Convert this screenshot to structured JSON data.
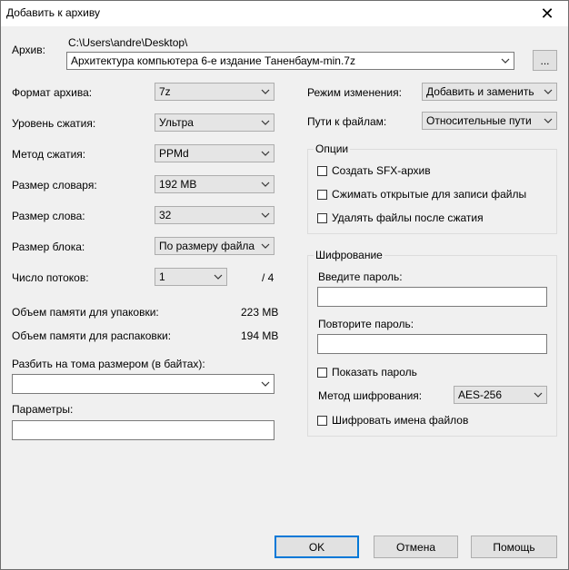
{
  "window": {
    "title": "Добавить к архиву"
  },
  "archive": {
    "label": "Архив:",
    "path": "C:\\Users\\andre\\Desktop\\",
    "filename": "Архитектура компьютера 6-е издание Таненбаум-min.7z",
    "browse": "..."
  },
  "left": {
    "format": {
      "label": "Формат архива:",
      "value": "7z"
    },
    "level": {
      "label": "Уровень сжатия:",
      "value": "Ультра"
    },
    "method": {
      "label": "Метод сжатия:",
      "value": "PPMd"
    },
    "dict": {
      "label": "Размер словаря:",
      "value": "192 MB"
    },
    "word": {
      "label": "Размер слова:",
      "value": "32"
    },
    "block": {
      "label": "Размер блока:",
      "value": "По размеру файла"
    },
    "threads": {
      "label": "Число потоков:",
      "value": "1",
      "max": "/ 4"
    },
    "mem_pack": {
      "label": "Объем памяти для упаковки:",
      "value": "223 MB"
    },
    "mem_unpack": {
      "label": "Объем памяти для распаковки:",
      "value": "194 MB"
    },
    "split": {
      "label": "Разбить на тома размером (в байтах):",
      "value": ""
    },
    "params": {
      "label": "Параметры:",
      "value": ""
    }
  },
  "right": {
    "update_mode": {
      "label": "Режим изменения:",
      "value": "Добавить и заменить"
    },
    "path_mode": {
      "label": "Пути к файлам:",
      "value": "Относительные пути"
    },
    "options": {
      "title": "Опции",
      "sfx": "Создать SFX-архив",
      "shared": "Сжимать открытые для записи файлы",
      "delete": "Удалять файлы после сжатия"
    },
    "encryption": {
      "title": "Шифрование",
      "enter_label": "Введите пароль:",
      "repeat_label": "Повторите пароль:",
      "show": "Показать пароль",
      "method_label": "Метод шифрования:",
      "method_value": "AES-256",
      "encrypt_names": "Шифровать имена файлов"
    }
  },
  "buttons": {
    "ok": "OK",
    "cancel": "Отмена",
    "help": "Помощь"
  },
  "icons": {
    "close": "close-icon",
    "dropdown": "chevron-down-icon"
  }
}
